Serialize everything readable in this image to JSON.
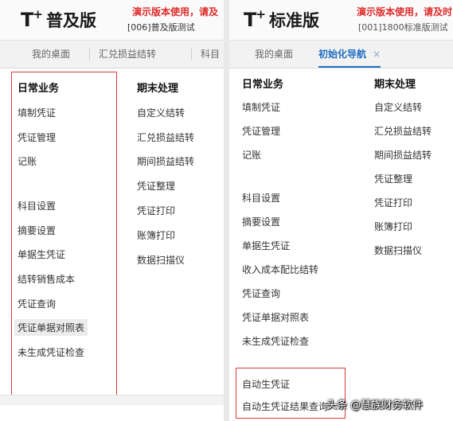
{
  "left": {
    "logo": {
      "mark": "T",
      "plus": "+",
      "name": "普及版"
    },
    "banner": "演示版本使用，请及",
    "company": "[006]普及版测试",
    "tabs": [
      "我的桌面",
      "汇兑损益结转",
      "科目"
    ],
    "daily": {
      "heading": "日常业务",
      "items": [
        "填制凭证",
        "凭证管理",
        "记账",
        "科目设置",
        "摘要设置",
        "单据生凭证",
        "结转销售成本",
        "凭证查询",
        "凭证单据对照表",
        "未生成凭证检查"
      ]
    },
    "period": {
      "heading": "期末处理",
      "items": [
        "自定义结转",
        "汇兑损益结转",
        "期间损益结转",
        "凭证整理",
        "凭证打印",
        "账簿打印",
        "数据扫描仪"
      ]
    }
  },
  "right": {
    "logo": {
      "mark": "T",
      "plus": "+",
      "name": "标准版"
    },
    "banner": "演示版本使用，请及时",
    "company": "[001]1800标准版测试",
    "tabs": [
      "我的桌面",
      "初始化导航"
    ],
    "tab_close": "×",
    "daily": {
      "heading": "日常业务",
      "items": [
        "填制凭证",
        "凭证管理",
        "记账",
        "科目设置",
        "摘要设置",
        "单据生凭证",
        "收入成本配比结转",
        "凭证查询",
        "凭证单据对照表",
        "未生成凭证检查",
        "自动生凭证",
        "自动生凭证结果查询"
      ]
    },
    "period": {
      "heading": "期末处理",
      "items": [
        "自定义结转",
        "汇兑损益结转",
        "期间损益结转",
        "凭证整理",
        "凭证打印",
        "账簿打印",
        "数据扫描仪"
      ]
    }
  },
  "watermark": "头条 @慧族财务软件",
  "colors": {
    "accent": "#1f6fc0",
    "highlight_box": "#d93a3a",
    "banner_text": "#e02a2a"
  }
}
